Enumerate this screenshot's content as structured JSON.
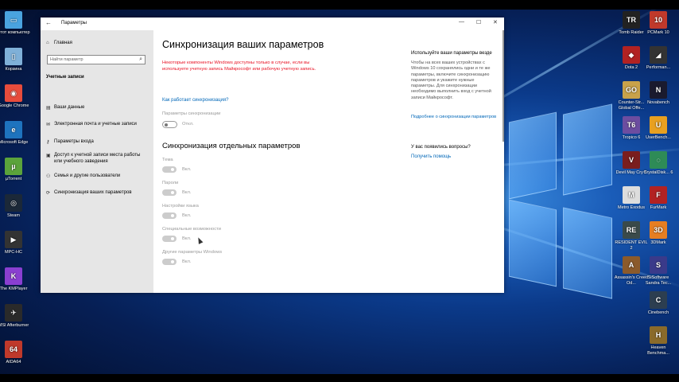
{
  "desktop": {
    "icons_left": [
      {
        "label": "Этот компьютер",
        "color": "#4aa3df",
        "glyph": "▭"
      },
      {
        "label": "Корзина",
        "color": "#7fb0d8",
        "glyph": "▯"
      },
      {
        "label": "Google Chrome",
        "color": "#e74c3c",
        "glyph": "◉"
      },
      {
        "label": "Microsoft Edge",
        "color": "#1e73be",
        "glyph": "e"
      },
      {
        "label": "µTorrent",
        "color": "#5ba33b",
        "glyph": "µ"
      },
      {
        "label": "Steam",
        "color": "#1b2838",
        "glyph": "◎"
      },
      {
        "label": "MPC-HC",
        "color": "#333",
        "glyph": "▶"
      },
      {
        "label": "The KMPlayer",
        "color": "#8a3fd1",
        "glyph": "K"
      },
      {
        "label": "MSI Afterburner",
        "color": "#2a2a2a",
        "glyph": "✈"
      },
      {
        "label": "AIDA64",
        "color": "#c0392b",
        "glyph": "64"
      }
    ],
    "icons_right_col1": [
      {
        "label": "Tomb Raider",
        "color": "#222",
        "glyph": "TR"
      },
      {
        "label": "Dota 2",
        "color": "#b22222",
        "glyph": "◆"
      },
      {
        "label": "Counter-Str... Global Offe...",
        "color": "#c8a24a",
        "glyph": "GO"
      },
      {
        "label": "Tropico 6",
        "color": "#6c4da0",
        "glyph": "T6"
      },
      {
        "label": "Devil May Cry 5",
        "color": "#7a1e1e",
        "glyph": "V"
      },
      {
        "label": "Metro Exodus",
        "color": "#ddd",
        "glyph": "M"
      },
      {
        "label": "RESIDENT EVIL 2",
        "color": "#3a4a4a",
        "glyph": "RE"
      },
      {
        "label": "Assassin's Creed Od...",
        "color": "#8b5a2b",
        "glyph": "A"
      }
    ],
    "icons_right_col2": [
      {
        "label": "PCMark 10",
        "color": "#c0392b",
        "glyph": "10"
      },
      {
        "label": "Performan...",
        "color": "#333",
        "glyph": "◢"
      },
      {
        "label": "Novabench",
        "color": "#1a1a2e",
        "glyph": "N"
      },
      {
        "label": "UserBench...",
        "color": "#e8a020",
        "glyph": "U"
      },
      {
        "label": "CrystalDisk... 6",
        "color": "#2e8b57",
        "glyph": "◌"
      },
      {
        "label": "FurMark",
        "color": "#b22222",
        "glyph": "F"
      },
      {
        "label": "3DMark",
        "color": "#e67e22",
        "glyph": "3D"
      },
      {
        "label": "SiSoftware Sandra Tec...",
        "color": "#3a3a8a",
        "glyph": "S"
      },
      {
        "label": "Cinebench",
        "color": "#2c3e50",
        "glyph": "C"
      },
      {
        "label": "Heaven Benchma...",
        "color": "#8a6a2a",
        "glyph": "H"
      }
    ]
  },
  "window": {
    "title": "Параметры",
    "controls": {
      "minimize": "—",
      "maximize": "☐",
      "close": "✕"
    }
  },
  "sidebar": {
    "home": "Главная",
    "search_placeholder": "Найти параметр",
    "section": "Учетные записи",
    "items": [
      {
        "label": "Ваши данные",
        "icon": "person-card-icon"
      },
      {
        "label": "Электронная почта и учетные записи",
        "icon": "mail-icon"
      },
      {
        "label": "Параметры входа",
        "icon": "key-icon"
      },
      {
        "label": "Доступ к учетной записи места работы или учебного заведения",
        "icon": "briefcase-icon"
      },
      {
        "label": "Семья и другие пользователи",
        "icon": "people-icon"
      },
      {
        "label": "Синхронизация ваших параметров",
        "icon": "sync-icon"
      }
    ]
  },
  "main": {
    "title": "Синхронизация ваших параметров",
    "warning": "Некоторые компоненты Windows доступны только в случае, если вы используете учетную запись Майкрософт или рабочую учетную запись.",
    "how_link": "Как работает синхронизация?",
    "sync_label": "Параметры синхронизации",
    "sync_state": "Откл.",
    "individual_title": "Синхронизация отдельных параметров",
    "settings": [
      {
        "label": "Тема",
        "state": "Вкл."
      },
      {
        "label": "Пароли",
        "state": "Вкл."
      },
      {
        "label": "Настройки языка",
        "state": "Вкл."
      },
      {
        "label": "Специальные возможности",
        "state": "Вкл."
      },
      {
        "label": "Другие параметры Windows",
        "state": "Вкл."
      }
    ]
  },
  "right_panel": {
    "title": "Используйте ваши параметры везде",
    "text": "Чтобы на всех ваших устройствах с Windows 10 сохранялись одни и те же параметры, включите синхронизацию параметров и укажите нужные параметры. Для синхронизации необходимо выполнить вход с учетной записи Майкрософт.",
    "more_link": "Подробнее о синхронизации параметров",
    "question_title": "У вас появились вопросы?",
    "help_link": "Получить помощь"
  }
}
